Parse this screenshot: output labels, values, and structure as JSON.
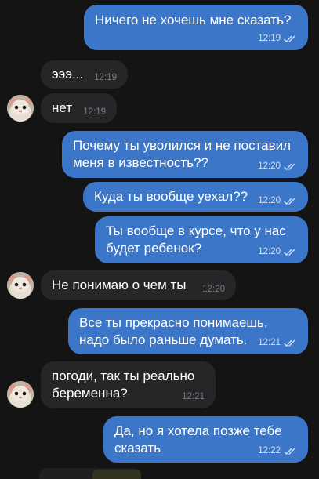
{
  "messages": [
    {
      "dir": "out",
      "text": "Ничего не хочешь мне сказать?",
      "time": "12:19",
      "read": true
    },
    {
      "dir": "in",
      "text": "эээ...",
      "time": "12:19"
    },
    {
      "dir": "in",
      "text": "нет",
      "time": "12:19",
      "avatar": "hamster-avatar"
    },
    {
      "dir": "out",
      "text": "Почему ты уволился и не поставил меня в известность??",
      "time": "12:20",
      "read": true
    },
    {
      "dir": "out",
      "text": "Куда ты вообще уехал??",
      "time": "12:20",
      "read": true
    },
    {
      "dir": "out",
      "text": "Ты вообще в курсе, что у нас будет ребенок?",
      "time": "12:20",
      "read": true
    },
    {
      "dir": "in",
      "text": "Не понимаю о чем ты",
      "time": "12:20",
      "avatar": "hamster-avatar"
    },
    {
      "dir": "out",
      "text": "Все ты прекрасно понимаешь, надо было раньше думать.",
      "time": "12:21",
      "read": true
    },
    {
      "dir": "in",
      "text": "погоди, так ты реально беременна?",
      "time": "12:21",
      "avatar": "hamster-avatar"
    },
    {
      "dir": "out",
      "text": "Да, но я хотела позже тебе сказать",
      "time": "12:22",
      "read": true
    }
  ],
  "colors": {
    "background": "#141414",
    "outgoing_bubble": "#3b76c8",
    "incoming_bubble": "#262628",
    "outgoing_meta": "#cfe0f7",
    "incoming_meta": "#7d7d82"
  }
}
